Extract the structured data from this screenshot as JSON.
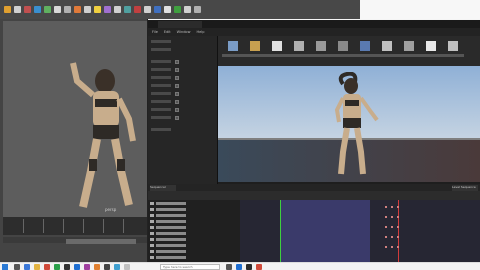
{
  "ue": {
    "menu": [
      "File",
      "Edit",
      "Window",
      "Help"
    ]
  },
  "maya": {
    "camera_label": "persp"
  },
  "sequencer": {
    "tab_left": "Sequencer",
    "tab_right": "Level Sequence"
  },
  "taskbar": {
    "search_placeholder": "Type here to search"
  },
  "colors": {
    "ue_bg": "#1e1e1e",
    "maya_bg": "#444444",
    "sequencer_range": "#3a3a6a",
    "start_green": "#3ecf3e",
    "end_red": "#d23b3b"
  }
}
